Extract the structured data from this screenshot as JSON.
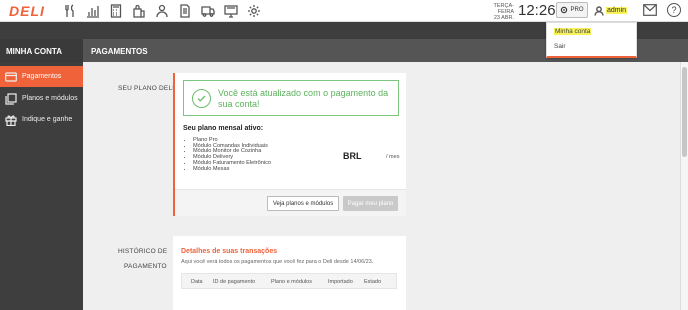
{
  "app": {
    "logo": "DELI"
  },
  "header": {
    "date": "TERÇA-FEIRA\n23 ABR.",
    "date_line1": "TERÇA-FEIRA",
    "date_line2": "23 ABR.",
    "time": "12:26",
    "pro_label": "PRO",
    "user": "admin",
    "help": "?",
    "nav_icons": [
      "utensils-icon",
      "chart-icon",
      "calculator-icon",
      "bags-icon",
      "delivery-person-icon",
      "documents-icon",
      "truck-icon",
      "monitor-icon",
      "settings-icon"
    ]
  },
  "user_menu": {
    "items": [
      "Minha conta",
      "Sair"
    ]
  },
  "section": {
    "left_title": "MINHA CONTA",
    "right_title": "PAGAMENTOS"
  },
  "sidebar": {
    "items": [
      {
        "label": "Pagamentos",
        "icon": "credit-card-icon",
        "active": true
      },
      {
        "label": "Planos e módulos",
        "icon": "copy-icon",
        "active": false
      },
      {
        "label": "Indique e ganhe",
        "icon": "gift-icon",
        "active": false
      }
    ]
  },
  "plan": {
    "section_label": "SEU PLANO DELI",
    "alert": "Você está atualizado com o pagamento da sua conta!",
    "title": "Seu plano mensal ativo:",
    "modules": [
      "Plano Pro",
      "Módulo Comandas Individuais",
      "Módulo Monitor de Cozinha",
      "Módulo Delivery",
      "Módulo Faturamento Eletrônico",
      "Módulo Mesas"
    ],
    "currency": "BRL",
    "period": "/ mes",
    "btn_plans": "Veja planos e módulos",
    "btn_pay": "Pagar meu plano"
  },
  "history": {
    "section_label_1": "HISTÓRICO DE",
    "section_label_2": "PAGAMENTO",
    "title": "Detalhes de suas transações",
    "subtitle": "Aqui você verá todos os pagamentos que você fez para o Deli desde 14/06/23.",
    "columns": [
      "Data",
      "ID de pagamento",
      "Plano e módulos",
      "Importado",
      "Estado"
    ]
  },
  "colors": {
    "accent": "#f0623a",
    "success": "#5cb25c",
    "sidebar": "#3e3e3e"
  }
}
